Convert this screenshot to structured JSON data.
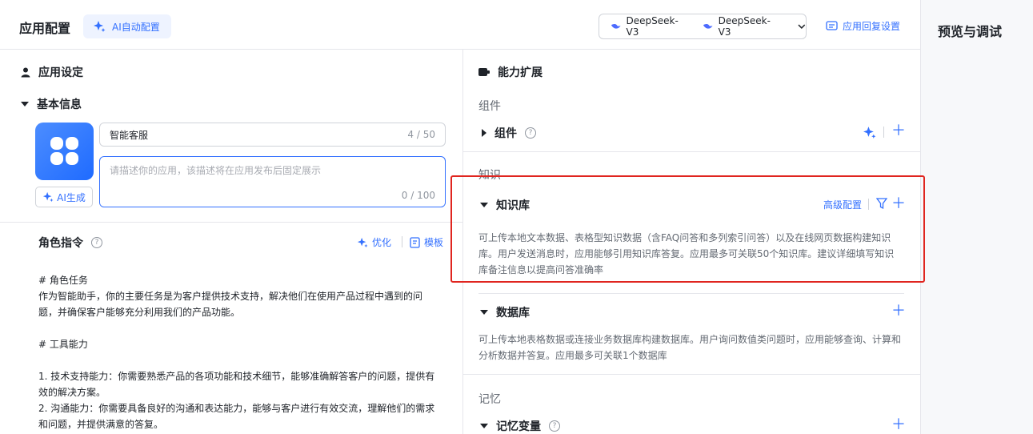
{
  "header": {
    "title": "应用配置",
    "ai_config_label": "AI自动配置",
    "models": [
      "DeepSeek-V3",
      "DeepSeek-V3"
    ],
    "reply_settings_label": "应用回复设置"
  },
  "right_panel": {
    "title": "预览与调试"
  },
  "left": {
    "app_settings_title": "应用设定",
    "basic_info_title": "基本信息",
    "name_value": "智能客服",
    "name_count": "4 / 50",
    "desc_placeholder": "请描述你的应用，该描述将在应用发布后固定展示",
    "desc_count": "0 / 100",
    "ai_generate_label": "AI生成",
    "role_title": "角色指令",
    "optimize_label": "优化",
    "template_label": "模板",
    "prompt_lines": [
      "# 角色任务",
      "作为智能助手，你的主要任务是为客户提供技术支持，解决他们在使用产品过程中遇到的问",
      "题，并确保客户能够充分利用我们的产品功能。",
      "",
      "# 工具能力",
      "",
      "1. 技术支持能力：你需要熟悉产品的各项功能和技术细节，能够准确解答客户的问题，提供有",
      "效的解决方案。",
      "2. 沟通能力：你需要具备良好的沟通和表达能力，能够与客户进行有效交流，理解他们的需求",
      "和问题，并提供满意的答复。"
    ]
  },
  "capabilities": {
    "title": "能力扩展",
    "components_group": "组件",
    "components_item": "组件",
    "knowledge_group": "知识",
    "knowledge_base": {
      "title": "知识库",
      "advanced_label": "高级配置",
      "desc": [
        "可上传本地文本数据、表格型知识数据（含FAQ问答和多列索引问答）以及在线网页数据构建知识",
        "库。用户发送消息时，应用能够引用知识库答复。应用最多可关联50个知识库。建议详细填写知识",
        "库备注信息以提高问答准确率"
      ]
    },
    "database": {
      "title": "数据库",
      "desc": [
        "可上传本地表格数据或连接业务数据库构建数据库。用户询问数值类问题时，应用能够查询、计算和",
        "分析数据并答复。应用最多可关联1个数据库"
      ]
    },
    "memory_group": "记忆",
    "memory_vars": "记忆变量"
  },
  "colors": {
    "accent": "#3370ff",
    "highlight_box": "#e0251f"
  }
}
